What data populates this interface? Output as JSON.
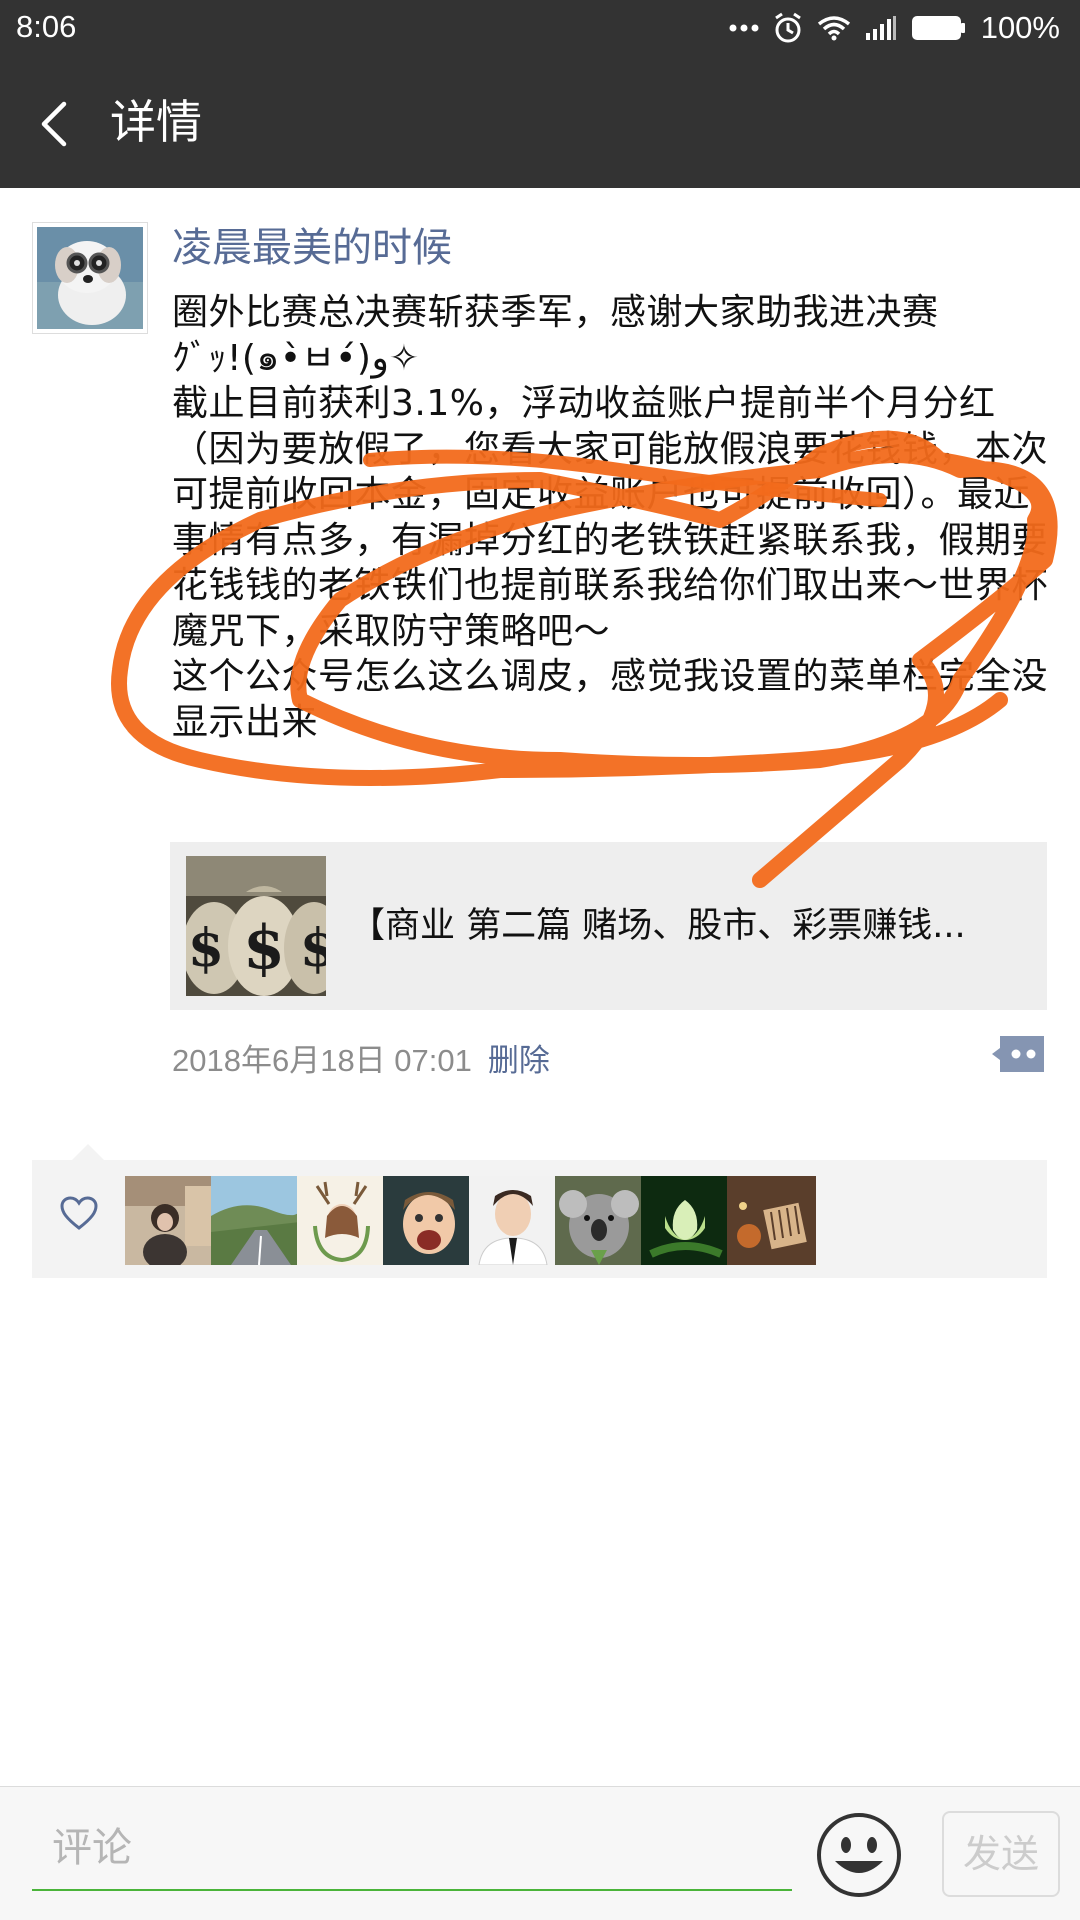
{
  "status_bar": {
    "time": "8:06",
    "battery": "100%",
    "icons": [
      "more-dots-icon",
      "alarm-icon",
      "wifi-icon",
      "signal-icon",
      "battery-icon"
    ]
  },
  "nav": {
    "title": "详情",
    "back_icon": "back-chevron-icon"
  },
  "post": {
    "author": "凌晨最美的时候",
    "text": "圈外比赛总决赛斩获季军，感谢大家助我进决赛\nｸﾞｯ!(๑•̀ㅂ•́)و✧\n截止目前获利3.1%，浮动收益账户提前半个月分红（因为要放假了，您看大家可能放假浪要花钱钱，本次可提前收回本金，固定收益账户也可提前收回）。最近事情有点多，有漏掉分红的老铁铁赶紧联系我，假期要花钱钱的老铁铁们也提前联系我给你们取出来～世界杯魔咒下，采取防守策略吧～\n这个公众号怎么这么调皮，感觉我设置的菜单栏完全没显示出来",
    "link_title": "【商业  第二篇  赌场、股市、彩票赚钱...",
    "date": "2018年6月18日 07:01",
    "delete_label": "删除"
  },
  "likes": {
    "count": 8
  },
  "comment_bar": {
    "placeholder": "评论",
    "value": "",
    "send_label": "发送"
  },
  "colors": {
    "header_bg": "#333333",
    "link_blue": "#576b95",
    "annotation_orange": "#f26a1b",
    "input_underline": "#4ab43a"
  }
}
